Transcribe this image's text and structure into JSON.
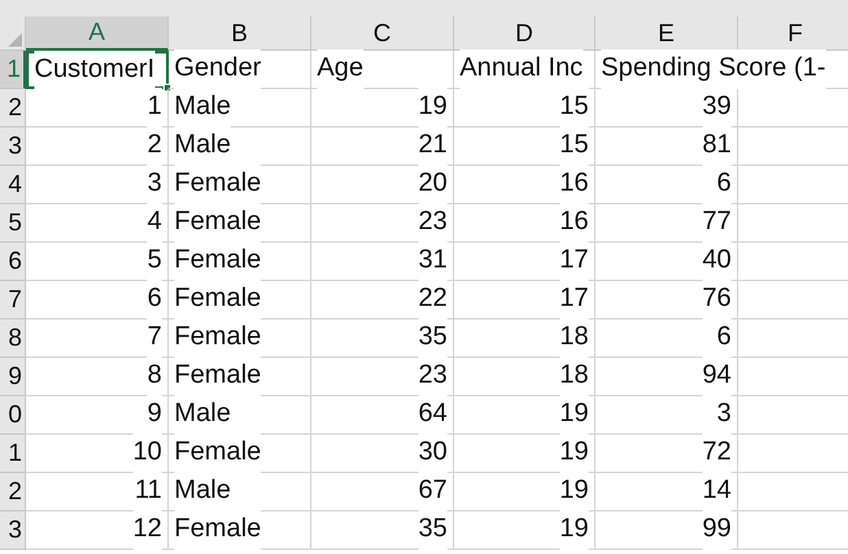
{
  "columns": [
    {
      "label": "A",
      "selected": true
    },
    {
      "label": "B",
      "selected": false
    },
    {
      "label": "C",
      "selected": false
    },
    {
      "label": "D",
      "selected": false
    },
    {
      "label": "E",
      "selected": false
    },
    {
      "label": "F",
      "selected": false
    }
  ],
  "rows": [
    {
      "number": "1",
      "selected": true,
      "cells": [
        {
          "text": "CustomerI",
          "kind": "text",
          "selected": true
        },
        {
          "text": "Gender",
          "kind": "text",
          "selected": false
        },
        {
          "text": "Age",
          "kind": "text",
          "selected": false
        },
        {
          "text": "Annual Inc",
          "kind": "text",
          "selected": false
        },
        {
          "text": "Spending Score (1-",
          "kind": "text",
          "selected": false
        }
      ]
    },
    {
      "number": "2",
      "selected": false,
      "cells": [
        {
          "text": "1",
          "kind": "number",
          "selected": false
        },
        {
          "text": "Male",
          "kind": "text",
          "selected": false
        },
        {
          "text": "19",
          "kind": "number",
          "selected": false
        },
        {
          "text": "15",
          "kind": "number",
          "selected": false
        },
        {
          "text": "39",
          "kind": "number",
          "selected": false
        }
      ]
    },
    {
      "number": "3",
      "selected": false,
      "cells": [
        {
          "text": "2",
          "kind": "number",
          "selected": false
        },
        {
          "text": "Male",
          "kind": "text",
          "selected": false
        },
        {
          "text": "21",
          "kind": "number",
          "selected": false
        },
        {
          "text": "15",
          "kind": "number",
          "selected": false
        },
        {
          "text": "81",
          "kind": "number",
          "selected": false
        }
      ]
    },
    {
      "number": "4",
      "selected": false,
      "cells": [
        {
          "text": "3",
          "kind": "number",
          "selected": false
        },
        {
          "text": "Female",
          "kind": "text",
          "selected": false
        },
        {
          "text": "20",
          "kind": "number",
          "selected": false
        },
        {
          "text": "16",
          "kind": "number",
          "selected": false
        },
        {
          "text": "6",
          "kind": "number",
          "selected": false
        }
      ]
    },
    {
      "number": "5",
      "selected": false,
      "cells": [
        {
          "text": "4",
          "kind": "number",
          "selected": false
        },
        {
          "text": "Female",
          "kind": "text",
          "selected": false
        },
        {
          "text": "23",
          "kind": "number",
          "selected": false
        },
        {
          "text": "16",
          "kind": "number",
          "selected": false
        },
        {
          "text": "77",
          "kind": "number",
          "selected": false
        }
      ]
    },
    {
      "number": "6",
      "selected": false,
      "cells": [
        {
          "text": "5",
          "kind": "number",
          "selected": false
        },
        {
          "text": "Female",
          "kind": "text",
          "selected": false
        },
        {
          "text": "31",
          "kind": "number",
          "selected": false
        },
        {
          "text": "17",
          "kind": "number",
          "selected": false
        },
        {
          "text": "40",
          "kind": "number",
          "selected": false
        }
      ]
    },
    {
      "number": "7",
      "selected": false,
      "cells": [
        {
          "text": "6",
          "kind": "number",
          "selected": false
        },
        {
          "text": "Female",
          "kind": "text",
          "selected": false
        },
        {
          "text": "22",
          "kind": "number",
          "selected": false
        },
        {
          "text": "17",
          "kind": "number",
          "selected": false
        },
        {
          "text": "76",
          "kind": "number",
          "selected": false
        }
      ]
    },
    {
      "number": "8",
      "selected": false,
      "cells": [
        {
          "text": "7",
          "kind": "number",
          "selected": false
        },
        {
          "text": "Female",
          "kind": "text",
          "selected": false
        },
        {
          "text": "35",
          "kind": "number",
          "selected": false
        },
        {
          "text": "18",
          "kind": "number",
          "selected": false
        },
        {
          "text": "6",
          "kind": "number",
          "selected": false
        }
      ]
    },
    {
      "number": "9",
      "selected": false,
      "cells": [
        {
          "text": "8",
          "kind": "number",
          "selected": false
        },
        {
          "text": "Female",
          "kind": "text",
          "selected": false
        },
        {
          "text": "23",
          "kind": "number",
          "selected": false
        },
        {
          "text": "18",
          "kind": "number",
          "selected": false
        },
        {
          "text": "94",
          "kind": "number",
          "selected": false
        }
      ]
    },
    {
      "number": "0",
      "selected": false,
      "cells": [
        {
          "text": "9",
          "kind": "number",
          "selected": false
        },
        {
          "text": "Male",
          "kind": "text",
          "selected": false
        },
        {
          "text": "64",
          "kind": "number",
          "selected": false
        },
        {
          "text": "19",
          "kind": "number",
          "selected": false
        },
        {
          "text": "3",
          "kind": "number",
          "selected": false
        }
      ]
    },
    {
      "number": "1",
      "selected": false,
      "cells": [
        {
          "text": "10",
          "kind": "number",
          "selected": false
        },
        {
          "text": "Female",
          "kind": "text",
          "selected": false
        },
        {
          "text": "30",
          "kind": "number",
          "selected": false
        },
        {
          "text": "19",
          "kind": "number",
          "selected": false
        },
        {
          "text": "72",
          "kind": "number",
          "selected": false
        }
      ]
    },
    {
      "number": "2",
      "selected": false,
      "cells": [
        {
          "text": "11",
          "kind": "number",
          "selected": false
        },
        {
          "text": "Male",
          "kind": "text",
          "selected": false
        },
        {
          "text": "67",
          "kind": "number",
          "selected": false
        },
        {
          "text": "19",
          "kind": "number",
          "selected": false
        },
        {
          "text": "14",
          "kind": "number",
          "selected": false
        }
      ]
    },
    {
      "number": "3",
      "selected": false,
      "cells": [
        {
          "text": "12",
          "kind": "number",
          "selected": false
        },
        {
          "text": "Female",
          "kind": "text",
          "selected": false
        },
        {
          "text": "35",
          "kind": "number",
          "selected": false
        },
        {
          "text": "19",
          "kind": "number",
          "selected": false
        },
        {
          "text": "99",
          "kind": "number",
          "selected": false
        }
      ]
    }
  ]
}
